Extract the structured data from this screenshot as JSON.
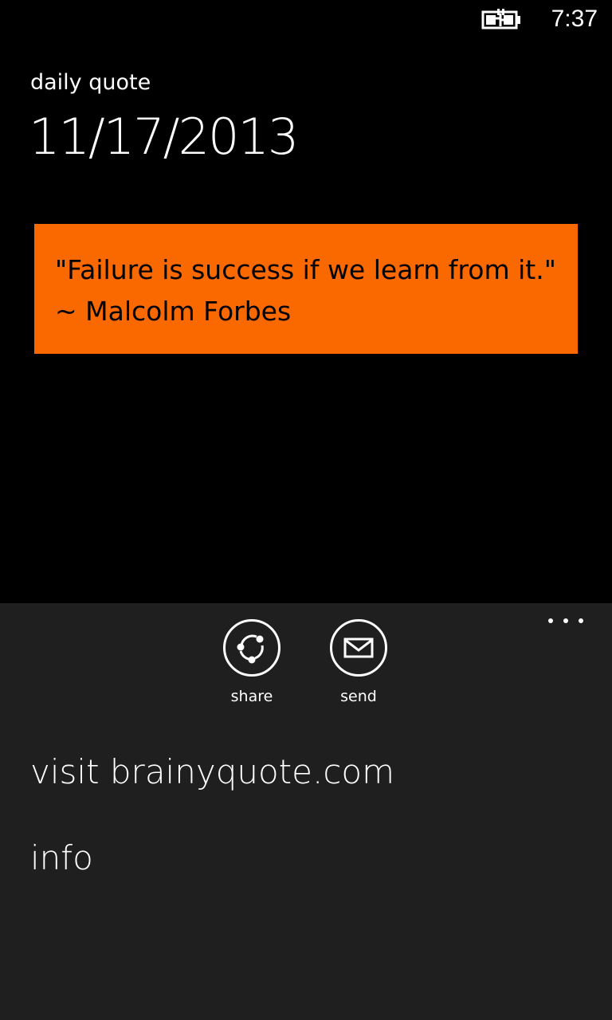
{
  "status_bar": {
    "battery_icon": "battery-charging-icon",
    "time": "7:37"
  },
  "header": {
    "app_title": "daily quote",
    "page_title": "11/17/2013"
  },
  "quote": {
    "text": "\"Failure is success if we learn from it.\" ~ Malcolm Forbes",
    "background_color": "#fa6800"
  },
  "app_bar": {
    "background_color": "#1f1f1f",
    "more_icon": "ellipsis-icon",
    "buttons": [
      {
        "icon": "share-icon",
        "label": "share"
      },
      {
        "icon": "mail-icon",
        "label": "send"
      }
    ],
    "menu_items": [
      {
        "label": "visit brainyquote.com"
      },
      {
        "label": "info"
      }
    ]
  }
}
